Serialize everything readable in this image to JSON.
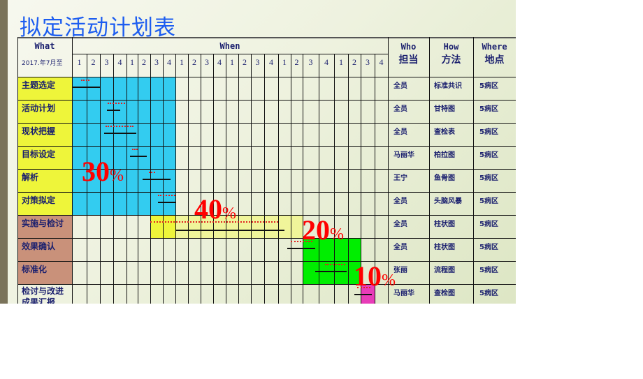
{
  "title": "拟定活动计划表",
  "header": {
    "what": "What",
    "when": "When",
    "date_label": "2017.年7月至",
    "who_en": "Who",
    "who_cn": "担当",
    "how_en": "How",
    "how_cn": "方法",
    "where_en": "Where",
    "where_cn": "地点",
    "weeks": [
      "1",
      "2",
      "3",
      "4",
      "1",
      "2",
      "3",
      "4",
      "1",
      "2",
      "3",
      "4",
      "1",
      "2",
      "3",
      "4",
      "1",
      "2",
      "3",
      "4",
      "1",
      "2",
      "3",
      "4"
    ]
  },
  "rows": [
    {
      "what": "主题选定",
      "who": "全员",
      "how": "标准共识",
      "where": "5病区",
      "phase": "plan"
    },
    {
      "what": "活动计划",
      "who": "全员",
      "how": "甘特图",
      "where": "5病区",
      "phase": "plan"
    },
    {
      "what": "现状把握",
      "who": "全员",
      "how": "查检表",
      "where": "5病区",
      "phase": "plan"
    },
    {
      "what": "目标设定",
      "who": "马丽华",
      "how": "柏拉图",
      "where": "5病区",
      "phase": "plan"
    },
    {
      "what": "解析",
      "who": "王宁",
      "how": "鱼骨图",
      "where": "5病区",
      "phase": "plan"
    },
    {
      "what": "对策拟定",
      "who": "全员",
      "how": "头脑风暴",
      "where": "5病区",
      "phase": "plan"
    },
    {
      "what": "实施与检讨",
      "who": "全员",
      "how": "柱状图",
      "where": "5病区",
      "phase": "do"
    },
    {
      "what": "效果确认",
      "who": "全员",
      "how": "柱状图",
      "where": "5病区",
      "phase": "check"
    },
    {
      "what": "标准化",
      "who": "张丽",
      "how": "流程图",
      "where": "5病区",
      "phase": "check"
    },
    {
      "what": "检讨与改进成果汇报",
      "who": "马丽华",
      "how": "查检图",
      "where": "5病区",
      "phase": "act"
    }
  ],
  "phases": [
    {
      "name": "plan",
      "percent_label": "30",
      "color": "#33ccf0"
    },
    {
      "name": "do",
      "percent_label": "40",
      "color": "#eef53a"
    },
    {
      "name": "check",
      "percent_label": "20",
      "color": "#00ee00"
    },
    {
      "name": "act",
      "percent_label": "10",
      "color": "#e83cb8"
    }
  ],
  "percent_sign": "%",
  "colors": {
    "what_plan_bg": "#eef53a",
    "what_do_bg": "#c9917a",
    "header_text": "#1a1f6e",
    "title": "#1d5df0",
    "percent": "#ff0000"
  },
  "gantt": {
    "comment": "start/end in week-column units (0-24); plan = dotted red, actual = solid black",
    "tasks": [
      {
        "plan": [
          0.6,
          1.2
        ],
        "actual": [
          0,
          2
        ]
      },
      {
        "plan": [
          2.6,
          3.9
        ],
        "actual": [
          2.5,
          3.5
        ]
      },
      {
        "plan": [
          2.4,
          4.6
        ],
        "actual": [
          2.3,
          4.9
        ]
      },
      {
        "plan": [
          4.5,
          5.0
        ],
        "actual": [
          4.3,
          5.7
        ]
      },
      {
        "plan": [
          5.9,
          6.4
        ],
        "actual": [
          5.4,
          7.6
        ]
      },
      {
        "plan": [
          6.6,
          8.0
        ],
        "actual": [
          6.6,
          8.0
        ]
      },
      {
        "plan": [
          6.0,
          16.0
        ],
        "actual": [
          8.0,
          16.5
        ]
      },
      {
        "plan": [
          17.0,
          18.6
        ],
        "actual": [
          16.7,
          18.8
        ]
      },
      {
        "plan": [
          19.4,
          20.8
        ],
        "actual": [
          18.8,
          20.9
        ]
      },
      {
        "plan": [
          21.7,
          22.7
        ],
        "actual": [
          21.5,
          22.8
        ]
      }
    ]
  }
}
